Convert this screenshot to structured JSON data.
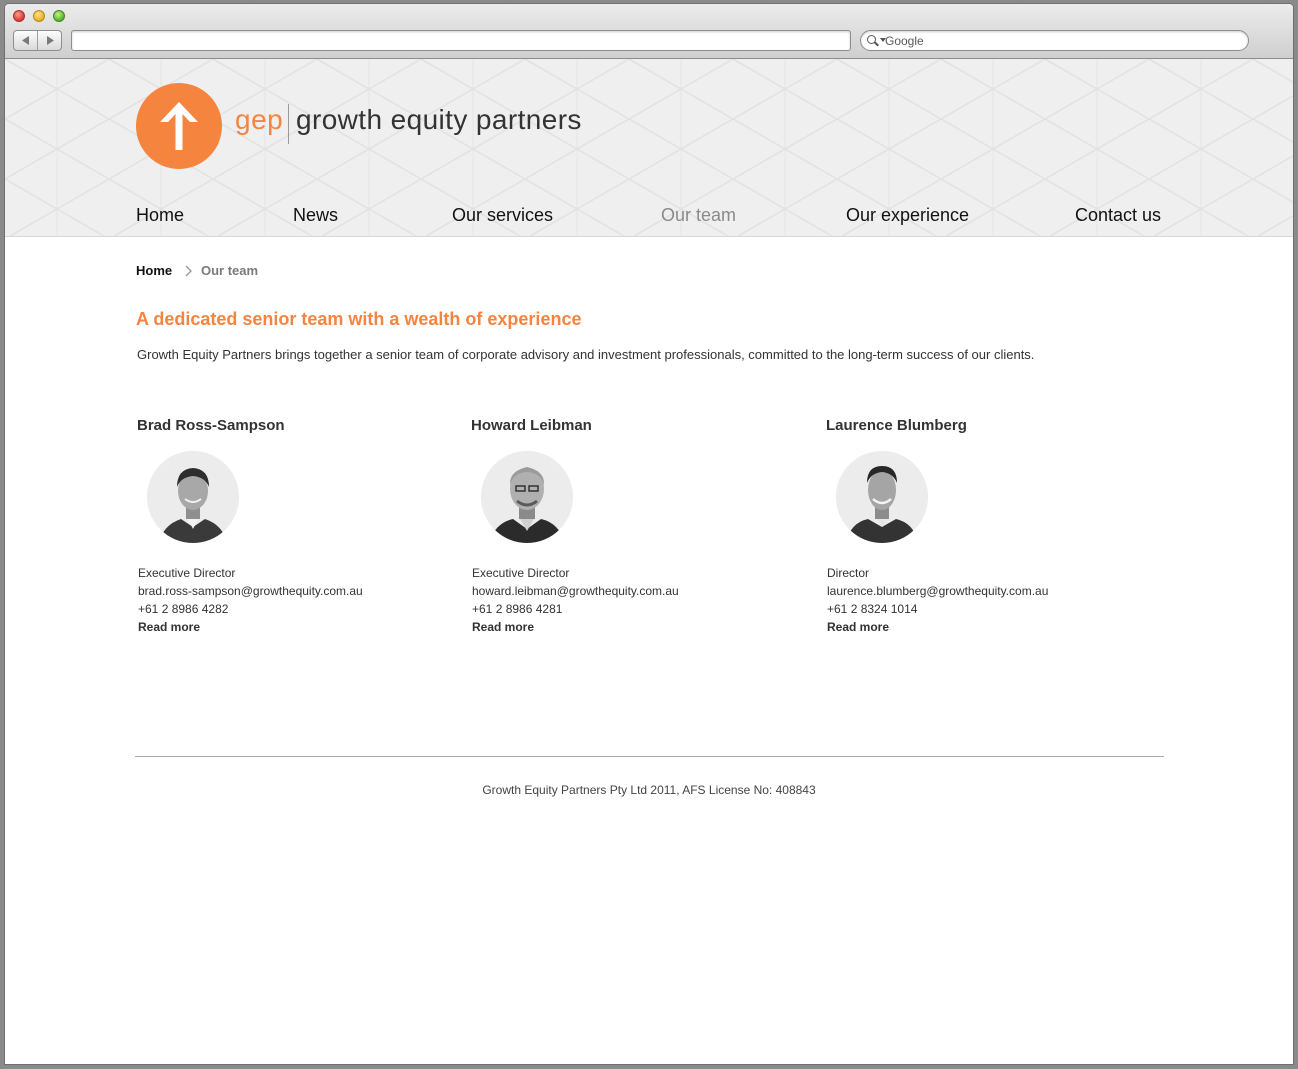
{
  "browser": {
    "search_placeholder": "Google"
  },
  "site": {
    "logo_short": "gep",
    "logo_name": "growth equity partners"
  },
  "nav": {
    "items": [
      {
        "label": "Home"
      },
      {
        "label": "News"
      },
      {
        "label": "Our services"
      },
      {
        "label": "Our team",
        "active": true
      },
      {
        "label": "Our experience"
      },
      {
        "label": "Contact us"
      }
    ]
  },
  "breadcrumb": {
    "home": "Home",
    "current": "Our team"
  },
  "main": {
    "headline": "A dedicated senior team with a wealth of experience",
    "intro": "Growth Equity Partners brings together a senior team of corporate advisory and investment professionals, committed to the long-term success of our clients."
  },
  "team": [
    {
      "name": "Brad Ross-Sampson",
      "role": "Executive Director",
      "email": "brad.ross-sampson@growthequity.com.au",
      "phone": "+61 2 8986 4282",
      "read_more": "Read more"
    },
    {
      "name": "Howard Leibman",
      "role": "Executive Director",
      "email": "howard.leibman@growthequity.com.au",
      "phone": "+61 2 8986 4281",
      "read_more": "Read more"
    },
    {
      "name": "Laurence Blumberg",
      "role": "Director",
      "email": "laurence.blumberg@growthequity.com.au",
      "phone": "+61 2 8324 1014",
      "read_more": "Read more"
    }
  ],
  "footer": {
    "text": "Growth Equity Partners Pty Ltd 2011, AFS License No: 408843"
  },
  "colors": {
    "accent": "#f5843e",
    "nav_active": "#8a8a8a"
  }
}
